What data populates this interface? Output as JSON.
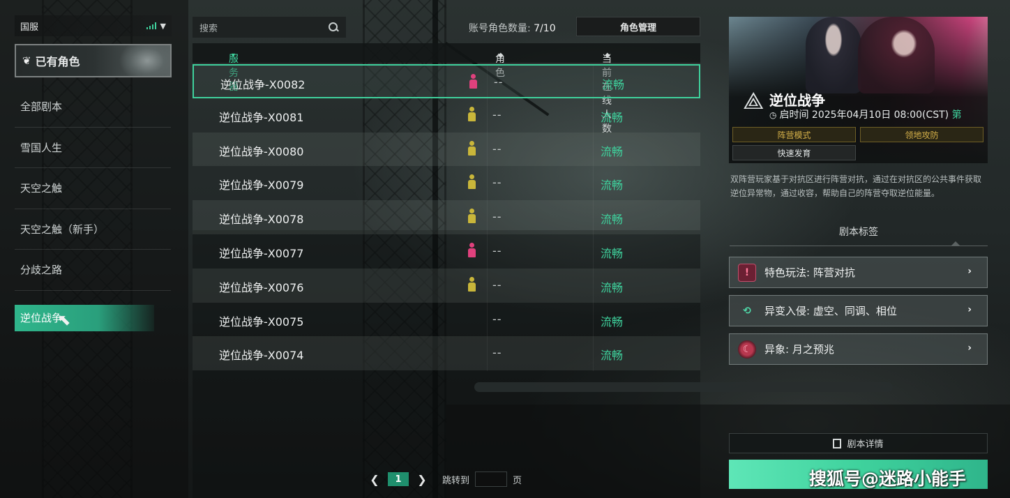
{
  "region": {
    "label": "国服"
  },
  "have_role": {
    "label": "已有角色"
  },
  "script_list": [
    {
      "label": "全部剧本"
    },
    {
      "label": "雪国人生"
    },
    {
      "label": "天空之触"
    },
    {
      "label": "天空之触（新手）"
    },
    {
      "label": "分歧之路"
    },
    {
      "label": "逆位战争"
    }
  ],
  "search": {
    "placeholder": "搜索"
  },
  "role_count": {
    "label": "账号角色数量: ",
    "value": "7/10"
  },
  "role_manage": {
    "label": "角色管理"
  },
  "table": {
    "columns": {
      "server": "服务器",
      "role": "角色",
      "online": "当前在线人数"
    },
    "rows": [
      {
        "name": "逆位战争-X0082",
        "role_color": "#e0417d",
        "role": "--",
        "status": "流畅"
      },
      {
        "name": "逆位战争-X0081",
        "role_color": "#c9b63a",
        "role": "--",
        "status": "流畅"
      },
      {
        "name": "逆位战争-X0080",
        "role_color": "#c9b63a",
        "role": "--",
        "status": "流畅"
      },
      {
        "name": "逆位战争-X0079",
        "role_color": "#c9b63a",
        "role": "--",
        "status": "流畅"
      },
      {
        "name": "逆位战争-X0078",
        "role_color": "#c9b63a",
        "role": "--",
        "status": "流畅"
      },
      {
        "name": "逆位战争-X0077",
        "role_color": "#e0417d",
        "role": "--",
        "status": "流畅"
      },
      {
        "name": "逆位战争-X0076",
        "role_color": "#c9b63a",
        "role": "--",
        "status": "流畅"
      },
      {
        "name": "逆位战争-X0075",
        "role_color": "",
        "role": "--",
        "status": "流畅"
      },
      {
        "name": "逆位战争-X0074",
        "role_color": "",
        "role": "--",
        "status": "流畅"
      }
    ]
  },
  "pager": {
    "current": "1",
    "jump_label": "跳转到",
    "page_suffix": "页"
  },
  "detail": {
    "title": "逆位战争",
    "start_label": "启时间 2025年04月10日 08:00(CST)",
    "start_suffix": "第",
    "tags": [
      "阵营模式",
      "领地攻防",
      "快速发育"
    ],
    "description": "双阵营玩家基于对抗区进行阵营对抗，通过在对抗区的公共事件获取逆位异常物，通过收容，帮助自己的阵营夺取逆位能量。",
    "tags_title": "剧本标签",
    "features": [
      {
        "label": "特色玩法: 阵营对抗",
        "icon": "shield-icon"
      },
      {
        "label": "异变入侵: 虚空、同调、相位",
        "icon": "triangle-recycle-icon"
      },
      {
        "label": "异象: 月之预兆",
        "icon": "moon-omen-icon"
      }
    ],
    "detail_button": "剧本详情"
  },
  "watermark": "搜狐号@迷路小能手",
  "colors": {
    "accent": "#3fd29d",
    "gold": "#d7b24a",
    "pink": "#e0417d"
  }
}
